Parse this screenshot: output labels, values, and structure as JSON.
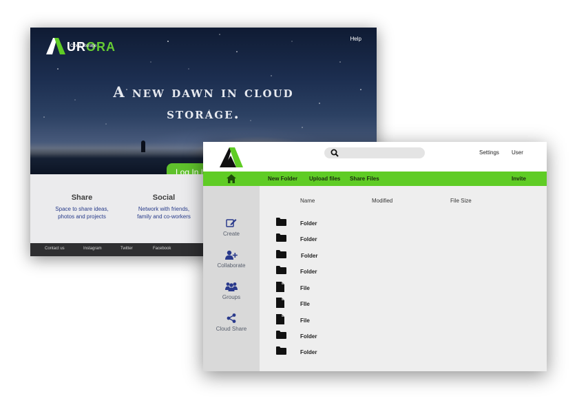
{
  "landing": {
    "brand": {
      "name_first": "A",
      "name_rest_white": "UR",
      "name_rest_green": "ORA",
      "subtitle": "Cloud Storage"
    },
    "help_label": "Help",
    "hero_title_line1": "A new dawn in cloud",
    "hero_title_line2": "storage.",
    "login_label": "Log In |",
    "features": [
      {
        "title": "Share",
        "desc_line1": "Space to share ideas,",
        "desc_line2": "photos and projects"
      },
      {
        "title": "Social",
        "desc_line1": "Network with friends,",
        "desc_line2": "family and co-workers"
      }
    ],
    "footer_links": [
      "Contact us",
      "Instagram",
      "Twitter",
      "Facebook"
    ]
  },
  "app": {
    "header": {
      "settings_label": "Settings",
      "user_label": "User",
      "search_placeholder": ""
    },
    "toolbar": {
      "home_icon": "home-icon",
      "new_folder_label": "New Folder",
      "upload_label": "Upload files",
      "share_label": "Share Files",
      "invite_label": "Invite"
    },
    "sidebar": [
      {
        "label": "Create",
        "icon": "edit-icon"
      },
      {
        "label": "Collaborate",
        "icon": "add-user-icon"
      },
      {
        "label": "Groups",
        "icon": "group-icon"
      },
      {
        "label": "Cloud Share",
        "icon": "share-icon"
      }
    ],
    "columns": {
      "name": "Name",
      "modified": "Modified",
      "size": "File Size"
    },
    "rows": [
      {
        "type": "folder",
        "name": "Folder"
      },
      {
        "type": "folder",
        "name": "Folder"
      },
      {
        "type": "folder",
        "name": "Folder"
      },
      {
        "type": "folder",
        "name": "Folder"
      },
      {
        "type": "file",
        "name": "File"
      },
      {
        "type": "file",
        "name": "FIle"
      },
      {
        "type": "file",
        "name": "File"
      },
      {
        "type": "folder",
        "name": "Folder"
      },
      {
        "type": "folder",
        "name": "Folder"
      }
    ]
  },
  "colors": {
    "accent_green": "#5fcc25",
    "link_blue": "#263a8a",
    "footer_dark": "#2f2f31"
  }
}
